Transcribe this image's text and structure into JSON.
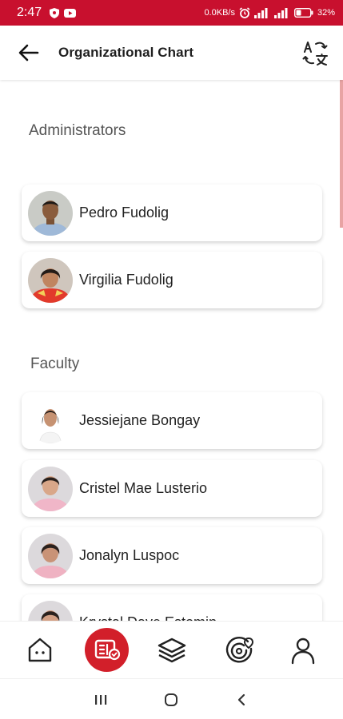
{
  "status_bar": {
    "time": "2:47",
    "network_speed": "0.0KB/s",
    "battery": "32%",
    "background_color": "#c8102e",
    "icons": [
      "shield-icon",
      "youtube-icon",
      "alarm-icon",
      "signal-icon",
      "signal-icon",
      "battery-icon"
    ]
  },
  "header": {
    "title": "Organizational Chart",
    "back_icon": "arrow-left-icon",
    "translate_icon": "translate-icon"
  },
  "sections": [
    {
      "label": "Administrators",
      "people": [
        {
          "name": "Pedro Fudolig",
          "avatar": "photo-man-blue-shirt"
        },
        {
          "name": "Virgilia Fudolig",
          "avatar": "photo-woman-red-dress"
        }
      ]
    },
    {
      "label": "Faculty",
      "people": [
        {
          "name": "Jessiejane Bongay",
          "avatar": "photo-woman-white-top"
        },
        {
          "name": "Cristel Mae Lusterio",
          "avatar": "photo-woman-pink-top"
        },
        {
          "name": "Jonalyn Luspoc",
          "avatar": "photo-woman-pink-top"
        },
        {
          "name": "Krystal Dave Estomin",
          "avatar": "photo-woman-pink-top"
        }
      ]
    }
  ],
  "bottom_nav": {
    "items": [
      "home-icon",
      "school-id-icon",
      "layers-icon",
      "location-radar-icon",
      "profile-icon"
    ],
    "active_index": 1,
    "active_color": "#d21f2a"
  },
  "system_nav": [
    "recents-icon",
    "home-circle-icon",
    "back-chevron-icon"
  ]
}
